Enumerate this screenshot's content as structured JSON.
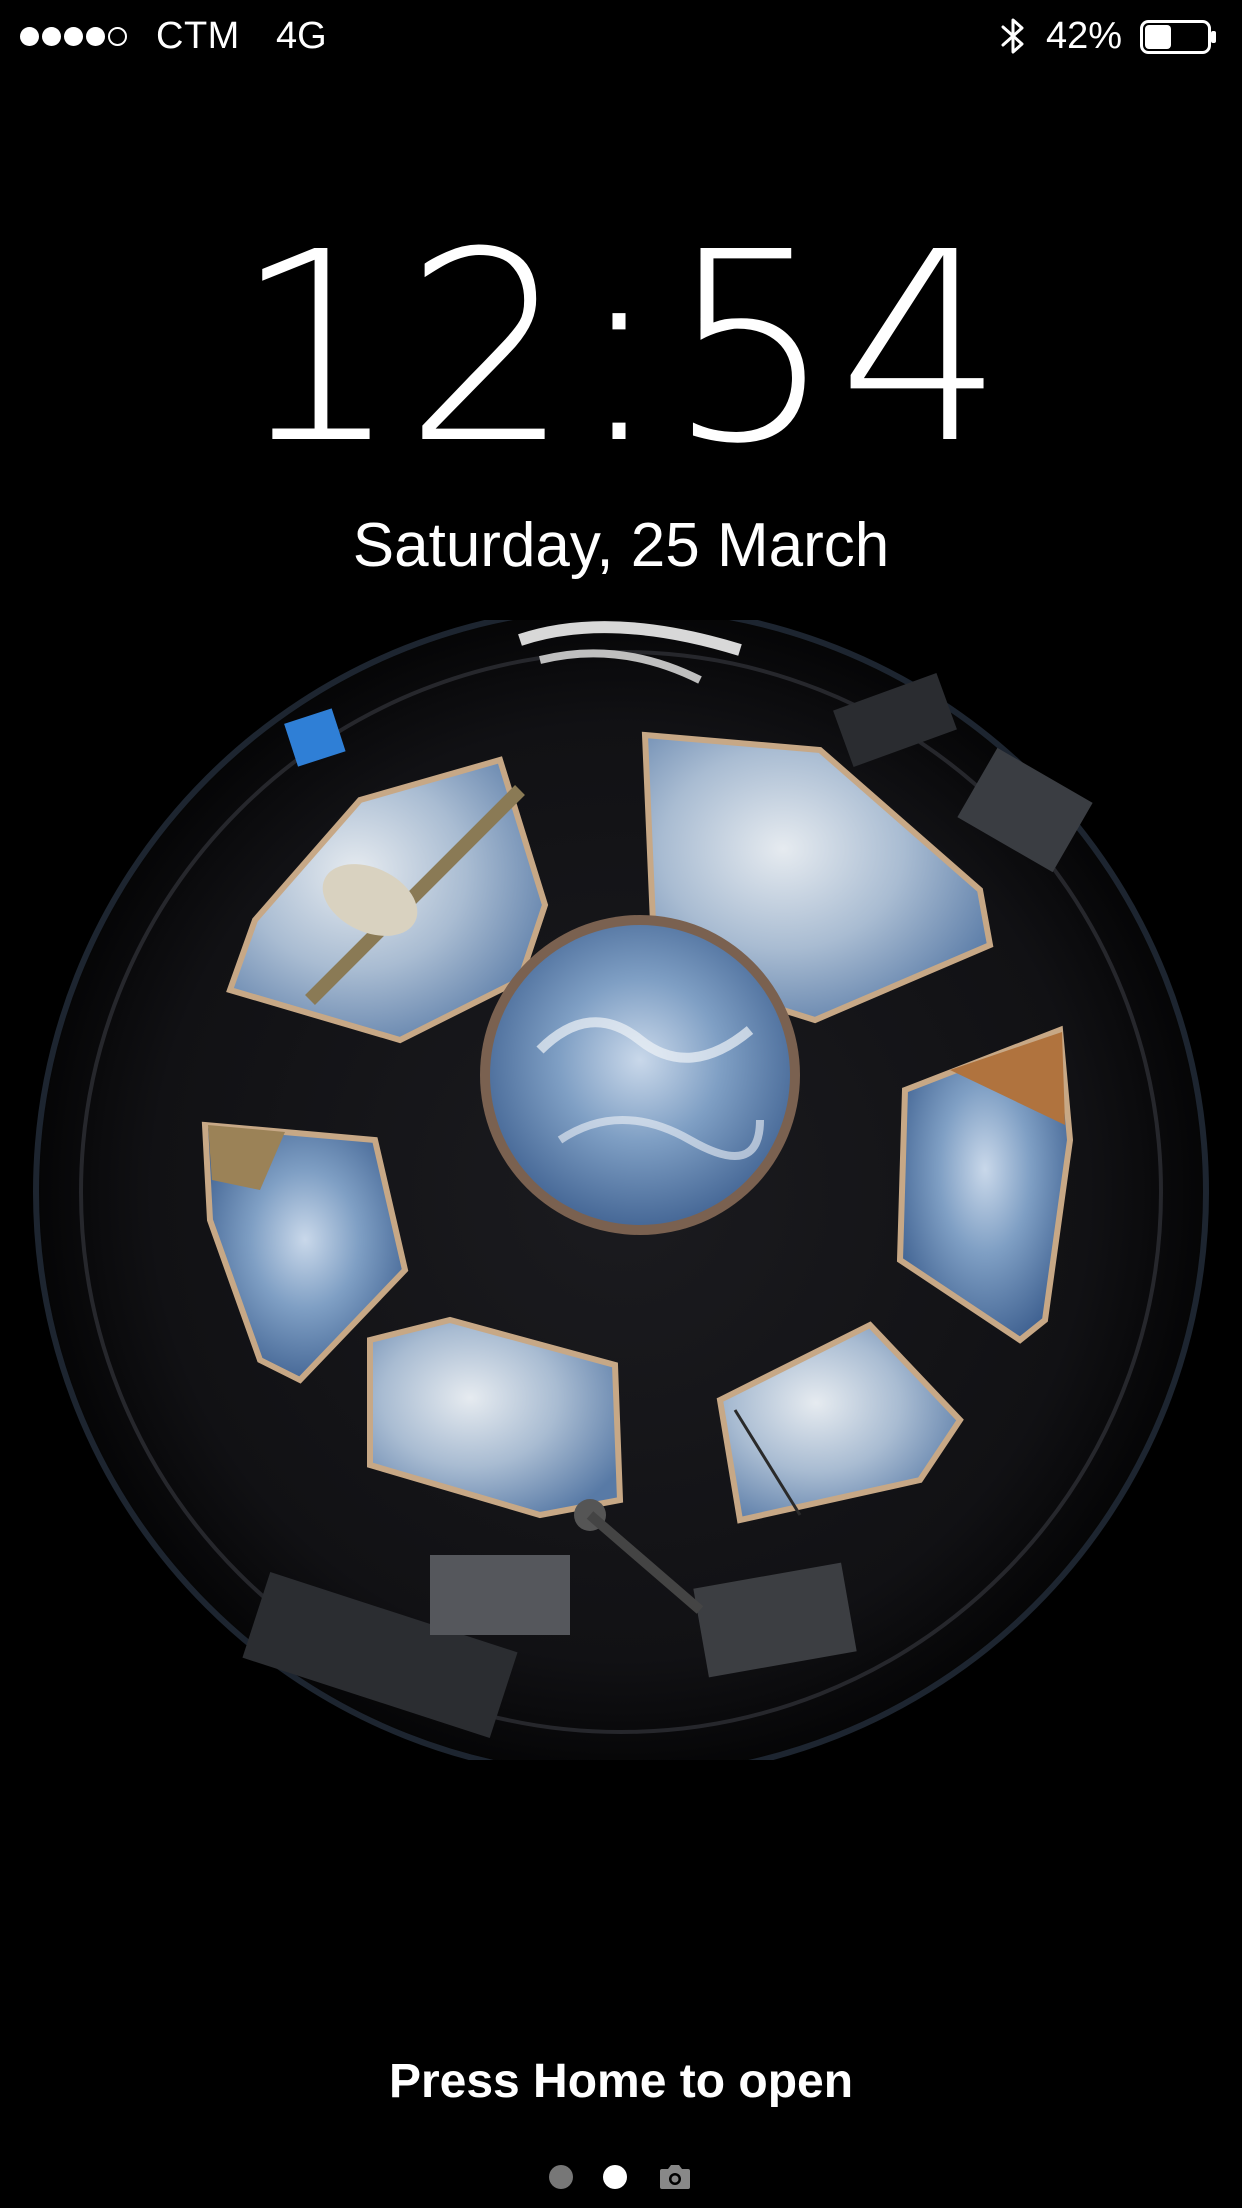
{
  "status_bar": {
    "signal_bars_filled": 4,
    "signal_bars_total": 5,
    "carrier": "CTM",
    "network": "4G",
    "bluetooth_icon": "bluetooth-icon",
    "battery_percent_label": "42%",
    "battery_level": 0.42
  },
  "lock_screen": {
    "time": "12:54",
    "date": "Saturday, 25 March",
    "wallpaper": "iss-cupola-earth-view",
    "unlock_hint": "Press Home to open"
  },
  "pager": {
    "pages": 2,
    "active_index": 1,
    "camera_icon": "camera-icon"
  },
  "colors": {
    "background": "#000000",
    "text": "#ffffff",
    "inactive_dot": "#777777"
  }
}
